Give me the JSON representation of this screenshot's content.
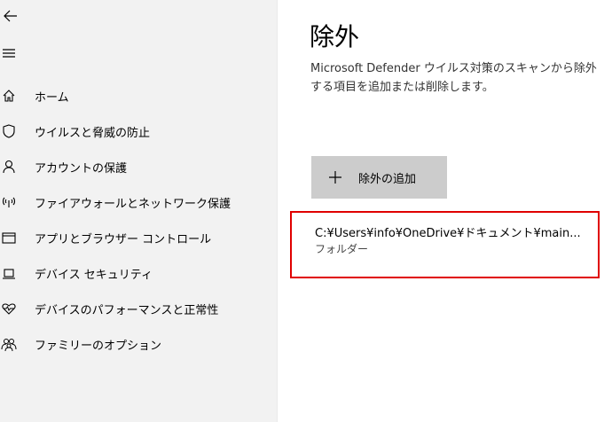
{
  "nav": {
    "items": [
      {
        "label": "ホーム",
        "icon": "home-icon"
      },
      {
        "label": "ウイルスと脅威の防止",
        "icon": "shield-icon"
      },
      {
        "label": "アカウントの保護",
        "icon": "person-icon"
      },
      {
        "label": "ファイアウォールとネットワーク保護",
        "icon": "wifi-icon"
      },
      {
        "label": "アプリとブラウザー コントロール",
        "icon": "app-window-icon"
      },
      {
        "label": "デバイス セキュリティ",
        "icon": "laptop-icon"
      },
      {
        "label": "デバイスのパフォーマンスと正常性",
        "icon": "heart-pulse-icon"
      },
      {
        "label": "ファミリーのオプション",
        "icon": "family-icon"
      }
    ]
  },
  "main": {
    "title": "除外",
    "description": "Microsoft Defender ウイルス対策のスキャンから除外する項目を追加または削除します。",
    "add_button_label": "除外の追加",
    "exclusion": {
      "path": "C:¥Users¥info¥OneDrive¥ドキュメント¥main...",
      "type": "フォルダー",
      "highlight_color": "#e00000"
    }
  }
}
